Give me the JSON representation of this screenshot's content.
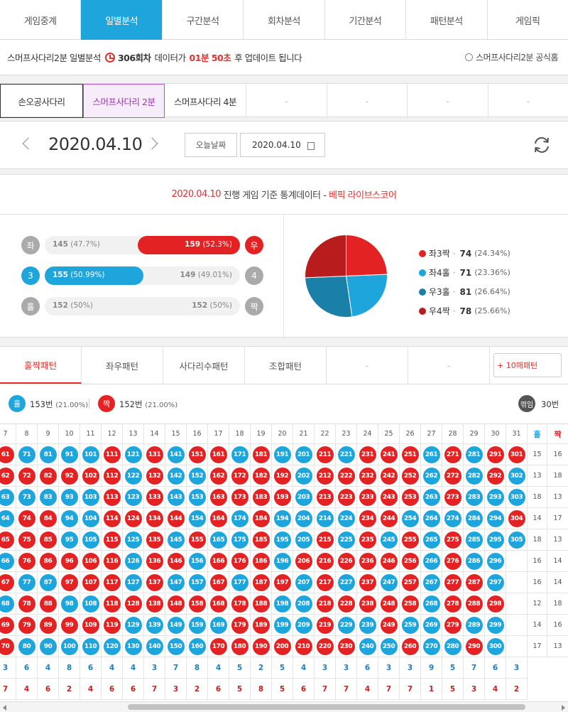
{
  "nav": {
    "tabs": [
      "게임중계",
      "일별분석",
      "구간분석",
      "회차분석",
      "기간분석",
      "패턴분석",
      "게임픽"
    ],
    "active_index": 1
  },
  "info": {
    "game": "스머프사다리2분 일별분석",
    "round": "306회차",
    "before_time": "데이터가",
    "time": "01분 50초",
    "after_time": "후 업데이트 됩니다",
    "homepage": "스머프사다리2분 공식홈"
  },
  "games": {
    "tabs": [
      "손오공사다리",
      "스머프사다리 2분",
      "스머프사다리 4분",
      "-",
      "-",
      "-",
      "-"
    ],
    "selected_index": 1
  },
  "date": {
    "display": "2020.04.10",
    "today_button": "오늘날짜",
    "input_value": "2020.04.10"
  },
  "stats": {
    "title_date": "2020.04.10",
    "title_mid": "진행 게임 기준 통계데이터 -",
    "title_brand": "베픽 라이브스코어",
    "rows": [
      {
        "left_label": "좌",
        "right_label": "우",
        "left_text": "145",
        "left_pct": "(47.7%)",
        "right_text": "159",
        "right_pct": "(52.3%)",
        "right_share": 0.523,
        "winner": "right",
        "color": "#e32323"
      },
      {
        "left_label": "3",
        "right_label": "4",
        "left_text": "155",
        "left_pct": "(50.99%)",
        "right_text": "149",
        "right_pct": "(49.01%)",
        "left_share": 0.5099,
        "winner": "left",
        "color": "#1ea6dc"
      },
      {
        "left_label": "홀",
        "right_label": "짝",
        "left_text": "152",
        "left_pct": "(50%)",
        "right_text": "152",
        "right_pct": "(50%)",
        "winner": "none",
        "color": "#aaaaaa"
      }
    ],
    "legend": [
      {
        "label": "좌3짝",
        "value": "74",
        "pct": "(24.34%)",
        "color": "#e32323"
      },
      {
        "label": "좌4홀",
        "value": "71",
        "pct": "(23.36%)",
        "color": "#1ea6dc"
      },
      {
        "label": "우3홀",
        "value": "81",
        "pct": "(26.64%)",
        "color": "#1a80a8"
      },
      {
        "label": "우4짝",
        "value": "78",
        "pct": "(25.66%)",
        "color": "#b81c1c"
      }
    ]
  },
  "pattern": {
    "tabs": [
      "홀짝패턴",
      "좌우패턴",
      "사다리수패턴",
      "조합패턴",
      "-",
      "-"
    ],
    "active_index": 0,
    "more_button": "+ 10매패턴"
  },
  "summary": {
    "odd_label": "홀",
    "odd_count": "153번",
    "odd_pct": "(21.00%)",
    "even_label": "짝",
    "even_count": "152번",
    "even_pct": "(21.00%)",
    "break_label": "꺾임",
    "break_count": "30번"
  },
  "grid": {
    "col_numbers": [
      "7",
      "8",
      "9",
      "10",
      "11",
      "12",
      "13",
      "14",
      "15",
      "16",
      "17",
      "18",
      "19",
      "20",
      "21",
      "22",
      "23",
      "24",
      "25",
      "26",
      "27",
      "28",
      "29",
      "30",
      "31"
    ],
    "col_start_values": [
      61,
      71,
      81,
      91,
      101,
      111,
      121,
      131,
      141,
      151,
      161,
      171,
      181,
      191,
      201,
      211,
      221,
      231,
      241,
      251,
      261,
      271,
      281,
      291,
      301
    ],
    "odd_header": "홀",
    "even_header": "짝",
    "columns": [
      "eeooeoeoee",
      "oeoeeeoeeo",
      "oeoeeeoeeo",
      "oeoooeeoeo",
      "oeoooeeoeo",
      "eeeeeeeeeo",
      "oooeoooeoo",
      "eeeeeeeeoo",
      "oooeoeoeoo",
      "eoooeooeoo",
      "eeeeoeeeoe",
      "oeeooeoeee",
      "eeeeeeeeee",
      "oeeoooeooe",
      "oooooeoooe",
      "eeeoeeeeee",
      "oeeooeoeoe",
      "eeeeeeeeoo",
      "eeeeoeoeeo",
      "eeeoeeeeoe",
      "oooooooooo",
      "eeeoeeeeeo",
      "ooooooeeoe",
      "eeoooooeoo",
      "eooeo"
    ],
    "row_odd_counts": [
      "15",
      "13",
      "18",
      "14",
      "18",
      "16",
      "16",
      "12",
      "14",
      "17"
    ],
    "row_even_counts": [
      "16",
      "18",
      "13",
      "17",
      "13",
      "14",
      "14",
      "18",
      "16",
      "13"
    ],
    "footer_odd": [
      "3",
      "6",
      "4",
      "8",
      "6",
      "4",
      "4",
      "3",
      "7",
      "8",
      "4",
      "5",
      "2",
      "5",
      "4",
      "3",
      "3",
      "6",
      "3",
      "3",
      "9",
      "5",
      "7",
      "6",
      "3"
    ],
    "footer_even": [
      "7",
      "4",
      "6",
      "2",
      "4",
      "6",
      "6",
      "7",
      "3",
      "2",
      "6",
      "5",
      "8",
      "5",
      "6",
      "7",
      "7",
      "4",
      "7",
      "7",
      "1",
      "5",
      "3",
      "4",
      "2"
    ]
  }
}
